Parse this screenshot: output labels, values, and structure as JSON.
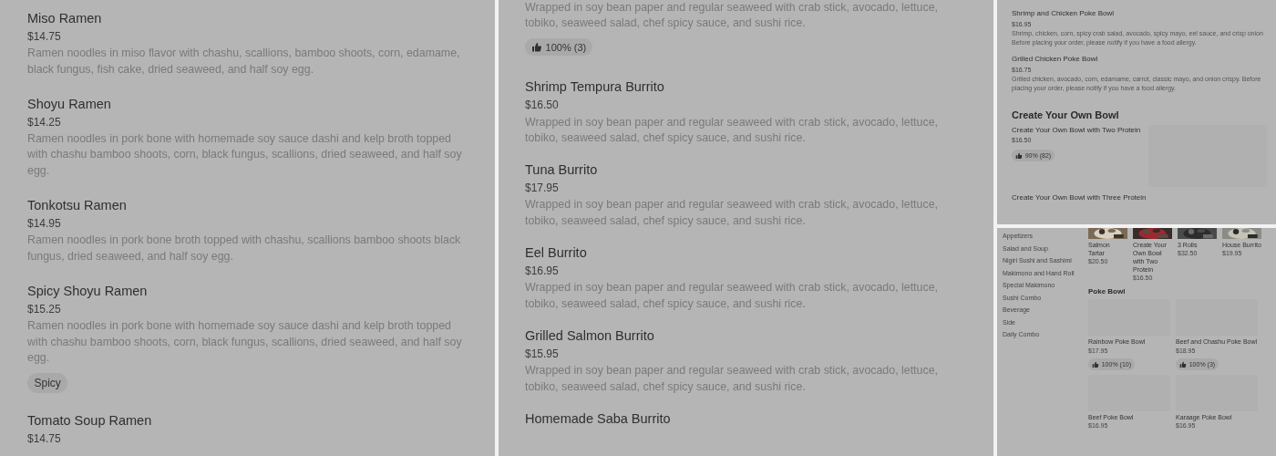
{
  "ramen_panel": {
    "items": [
      {
        "title": "Miso Ramen",
        "price": "$14.75",
        "description": "Ramen noodles in miso flavor with chashu, scallions, bamboo shoots, corn, edamame, black fungus, fish cake, dried seaweed, and half soy egg."
      },
      {
        "title": "Shoyu Ramen",
        "price": "$14.25",
        "description": "Ramen noodles in pork bone with homemade soy sauce dashi and kelp broth topped with chashu bamboo shoots, corn, black fungus, scallions, dried seaweed, and half soy egg."
      },
      {
        "title": "Tonkotsu Ramen",
        "price": "$14.95",
        "description": "Ramen noodles in pork bone broth topped with chashu, scallions bamboo shoots black fungus, dried seaweed, and half soy egg."
      },
      {
        "title": "Spicy Shoyu Ramen",
        "price": "$15.25",
        "description": "Ramen noodles in pork bone with homemade soy sauce dashi and kelp broth topped with chashu bamboo shoots, corn, black fungus, scallions, dried seaweed, and half soy egg.",
        "tag": "Spicy"
      },
      {
        "title": "Tomato Soup Ramen",
        "price": "$14.75"
      }
    ]
  },
  "burrito_panel": {
    "items": [
      {
        "description": "Wrapped in soy bean paper and regular seaweed with crab stick, avocado, lettuce, tobiko, seaweed salad, chef spicy sauce, and sushi rice.",
        "rating": "100% (3)"
      },
      {
        "title": "Shrimp Tempura Burrito",
        "price": "$16.50",
        "description": "Wrapped in soy bean paper and regular seaweed with crab stick, avocado, lettuce, tobiko, seaweed salad, chef spicy sauce, and sushi rice."
      },
      {
        "title": "Tuna Burrito",
        "price": "$17.95",
        "description": "Wrapped in soy bean paper and regular seaweed with crab stick, avocado, lettuce, tobiko, seaweed salad, chef spicy sauce, and sushi rice."
      },
      {
        "title": "Eel Burrito",
        "price": "$16.95",
        "description": "Wrapped in soy bean paper and regular seaweed with crab stick, avocado, lettuce, tobiko, seaweed salad, chef spicy sauce, and sushi rice."
      },
      {
        "title": "Grilled Salmon Burrito",
        "price": "$15.95",
        "description": "Wrapped in soy bean paper and regular seaweed with crab stick, avocado, lettuce, tobiko, seaweed salad, chef spicy sauce, and sushi rice."
      },
      {
        "title": "Homemade Saba Burrito"
      }
    ]
  },
  "poke_panel": {
    "items": [
      {
        "title": "Shrimp and Chicken Poke Bowl",
        "price": "$16.95",
        "description": "Shrimp, chicken, corn, spicy crab salad, avocado, spicy mayo, eel sauce, and crisp onion Before placing your order, please notify if you have a food allergy."
      },
      {
        "title": "Grilled Chicken Poke Bowl",
        "price": "$16.75",
        "description": "Grilled chicken, avocado, corn, edamame, carrot, classic mayo, and onion crispy. Before placing your order, please notify if you have a food allergy."
      }
    ],
    "section": {
      "title": "Create Your Own Bowl",
      "items": [
        {
          "title": "Create Your Own Bowl with Two Protein",
          "price": "$16.50",
          "rating": "90% (82)",
          "image": true
        },
        {
          "title": "Create Your Own Bowl with Three Protein"
        }
      ]
    }
  },
  "menu_page": {
    "categories": [
      "Appetizers",
      "Salad and Soup",
      "Nigiri Sushi and Sashimi",
      "Makimono and Hand Roll",
      "Special Makimono",
      "Sushi Combo",
      "Beverage",
      "Side",
      "Daily Combo"
    ],
    "featured": [
      {
        "title": "Salmon Tartar",
        "price": "$20.50",
        "kind": "picture"
      },
      {
        "title": "Create Your Own Bowl with Two Protein",
        "price": "$16.50",
        "kind": "picture"
      },
      {
        "title": "3 Rolls",
        "price": "$32.50",
        "kind": "picture"
      },
      {
        "title": "House Burrito",
        "price": "$19.95",
        "kind": "picture"
      }
    ],
    "section_title": "Poke Bowl",
    "grid": [
      {
        "title": "Rainbow Poke Bowl",
        "price": "$17.95",
        "rating": "100% (10)"
      },
      {
        "title": "Beef and Chashu Poke Bowl",
        "price": "$18.95",
        "rating": "100% (3)"
      },
      {
        "title": "Beef Poke Bowl",
        "price": "$16.95"
      },
      {
        "title": "Karaage Poke Bowl",
        "price": "$16.95"
      }
    ]
  }
}
